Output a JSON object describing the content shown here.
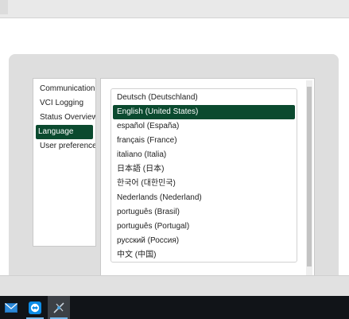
{
  "sidebar": {
    "items": [
      {
        "label": "Communication interfaces"
      },
      {
        "label": "VCI Logging"
      },
      {
        "label": "Status Overview"
      },
      {
        "label": "Language"
      },
      {
        "label": "User preferences"
      }
    ],
    "selected": "Language"
  },
  "languages": {
    "selected": "English (United States)",
    "options": [
      {
        "label": "Deutsch (Deutschland)"
      },
      {
        "label": "English (United States)"
      },
      {
        "label": "español (España)"
      },
      {
        "label": "français (France)"
      },
      {
        "label": "italiano (Italia)"
      },
      {
        "label": "日本語 (日本)"
      },
      {
        "label": "한국어 (대한민국)"
      },
      {
        "label": "Nederlands (Nederland)"
      },
      {
        "label": "português (Brasil)"
      },
      {
        "label": "português (Portugal)"
      },
      {
        "label": "русский (Россия)"
      },
      {
        "label": "中文 (中国)"
      }
    ]
  },
  "taskbar": {
    "icons": [
      "mail-icon",
      "teamviewer-icon",
      "diagnostic-app-icon"
    ]
  },
  "colors": {
    "accent": "#0b4a2f",
    "panel": "#dedede",
    "taskbar": "#111418"
  }
}
